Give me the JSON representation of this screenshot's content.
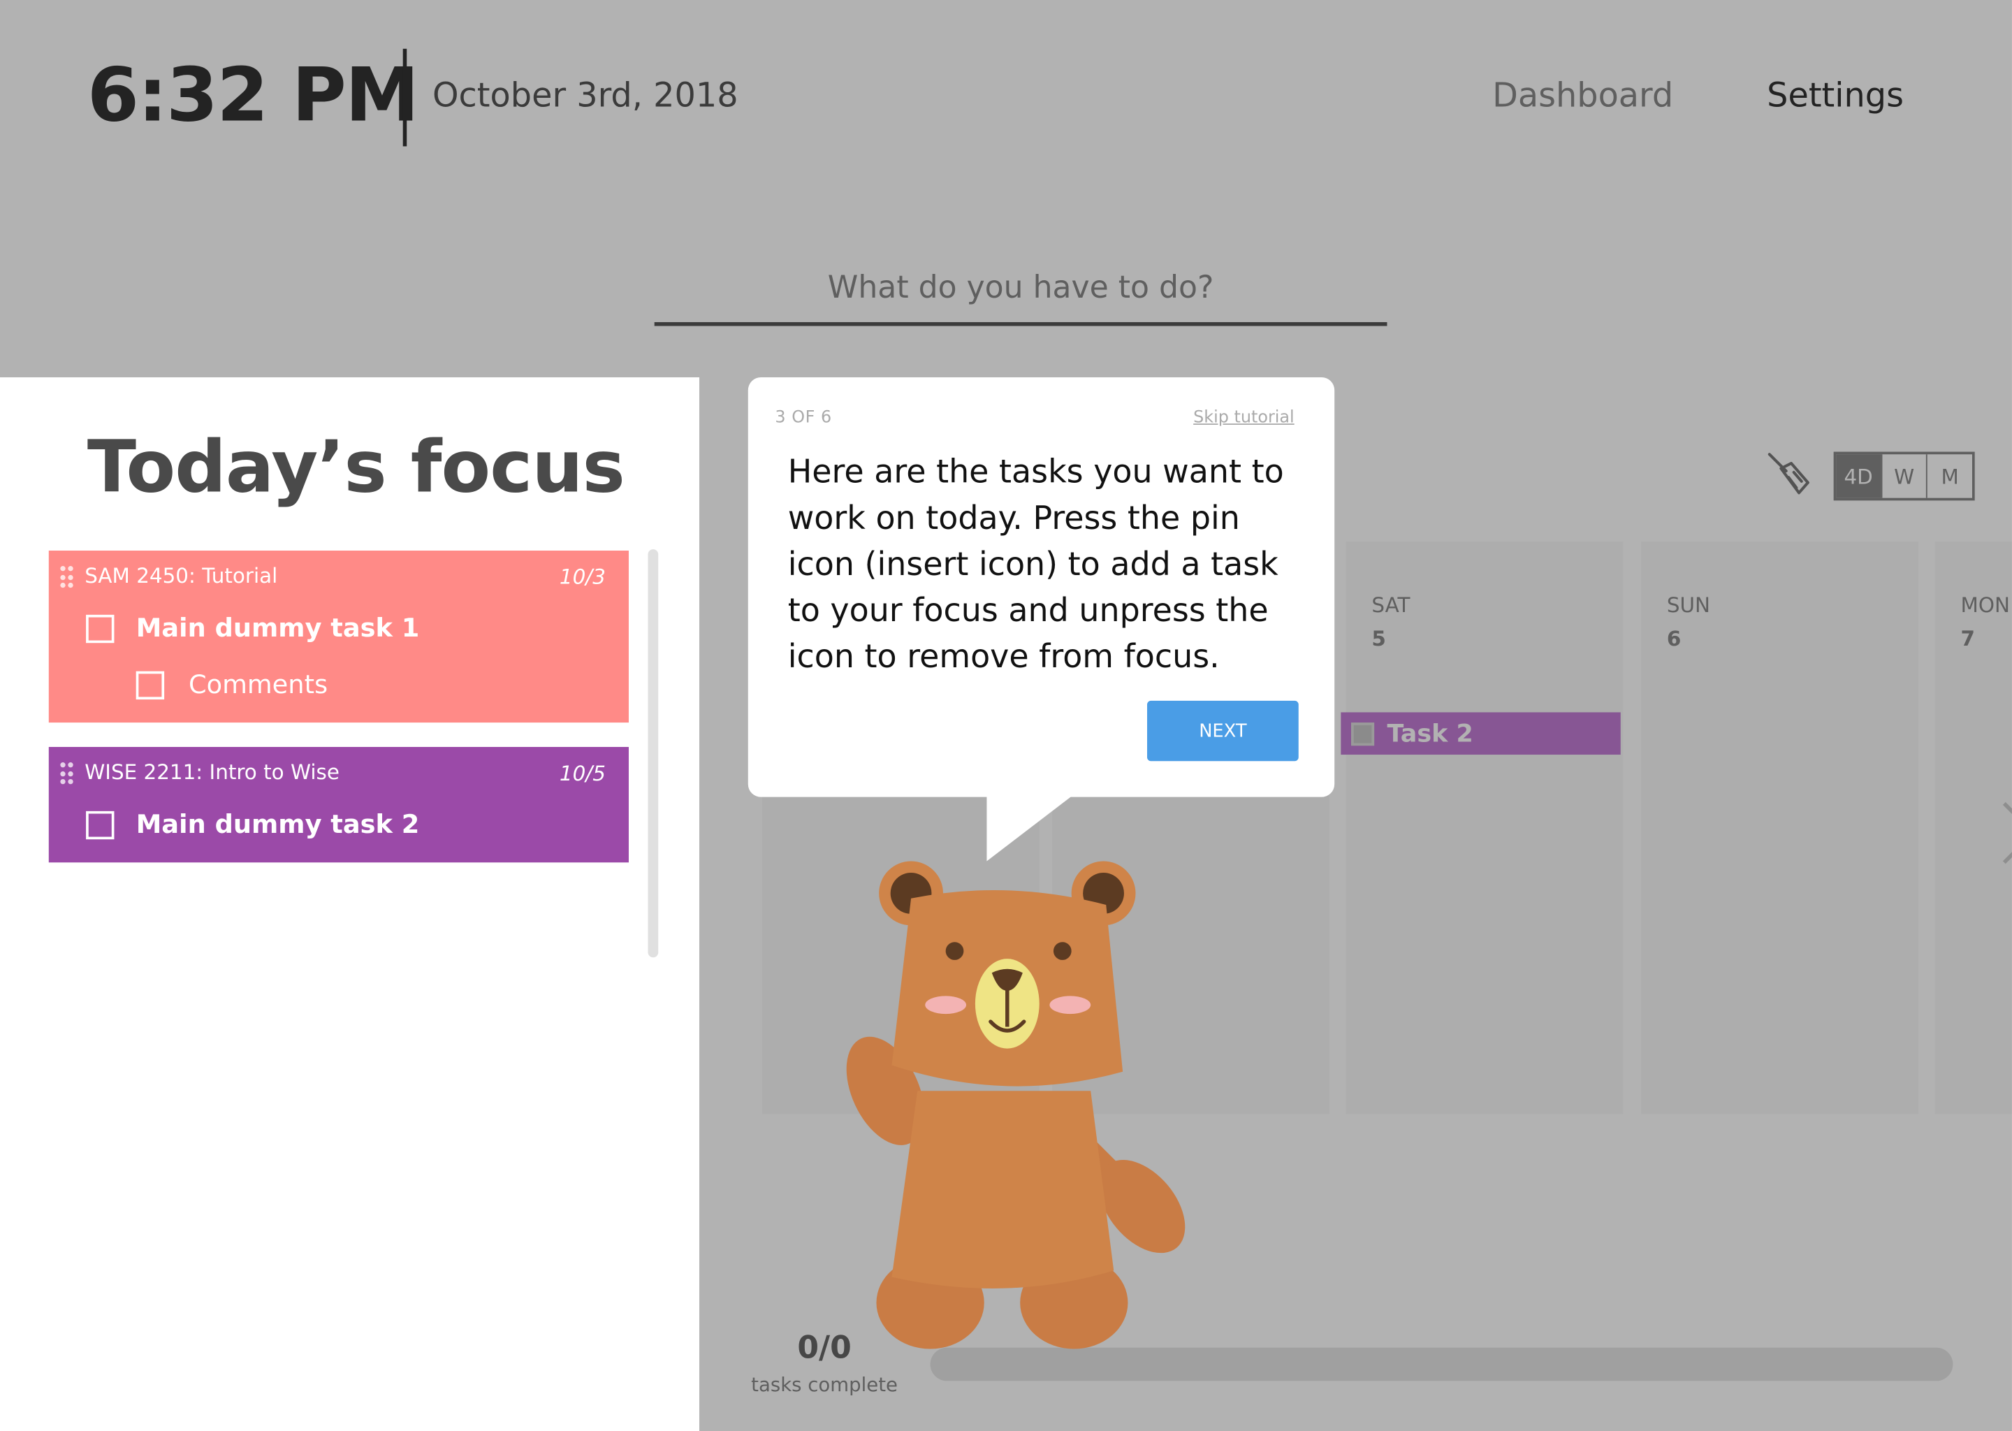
{
  "header": {
    "time": "6:32 PM",
    "date": "October 3rd, 2018",
    "nav": {
      "dashboard": "Dashboard",
      "settings": "Settings"
    },
    "task_input_placeholder": "What do you have to do?"
  },
  "focus": {
    "title": "Today’s focus",
    "cards": [
      {
        "course": "SAM 2450: Tutorial",
        "due": "10/3",
        "color": "#ff8a87",
        "task": "Main dummy task 1",
        "subtask": "Comments"
      },
      {
        "course": "WISE 2211: Intro to Wise",
        "due": "10/5",
        "color": "#9b4aa8",
        "task": "Main dummy task 2"
      }
    ]
  },
  "calendar": {
    "view_toggle": [
      "4D",
      "W",
      "M"
    ],
    "selected_view": "4D",
    "days": [
      {
        "name": "SAT",
        "num": "5"
      },
      {
        "name": "SUN",
        "num": "6"
      },
      {
        "name": "MON",
        "num": "7"
      }
    ],
    "task": {
      "label": "Task 2",
      "color": "#c27bd4"
    },
    "progress": {
      "count": "0/0",
      "label": "tasks complete",
      "fraction": 0
    }
  },
  "tutorial": {
    "step": "3 OF 6",
    "skip": "Skip tutorial",
    "message": "Here are the tasks you want to work on today. Press the pin icon (insert icon) to add a task to your focus and unpress the icon to remove from focus.",
    "next": "NEXT"
  },
  "icons": {
    "broom": "broom-icon",
    "drag": "drag-handle-icon",
    "mascot": "bear-mascot-icon",
    "next_arrow": "chevron-right-icon"
  },
  "colors": {
    "accent": "#4a9de6",
    "overlay": "rgba(0,0,0,0.30)"
  }
}
